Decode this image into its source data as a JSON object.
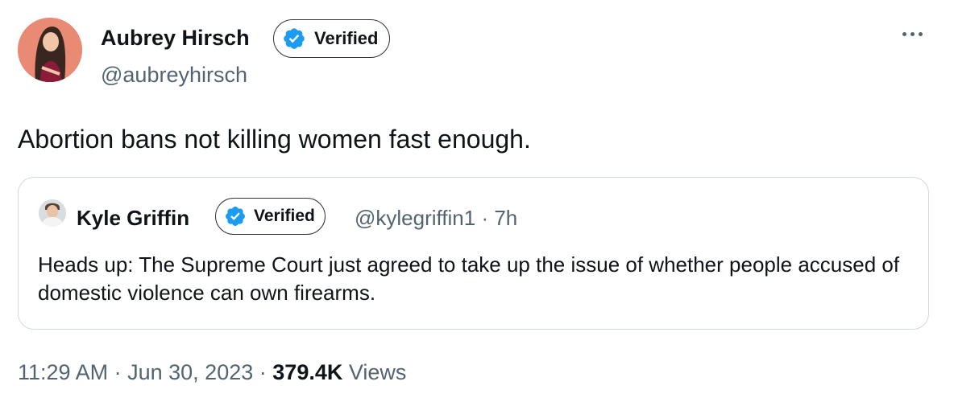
{
  "tweet": {
    "author": {
      "name": "Aubrey Hirsch",
      "handle": "@aubreyhirsch",
      "verified_label": "Verified"
    },
    "text": "Abortion bans not killing women fast enough.",
    "quoted": {
      "author_name": "Kyle Griffin",
      "verified_label": "Verified",
      "handle": "@kylegriffin1",
      "separator": "·",
      "age": "7h",
      "text": "Heads up: The Supreme Court just agreed to take up the issue of whether people accused of domestic violence can own firearms."
    },
    "footer": {
      "time": "11:29 AM",
      "separator": "·",
      "date": "Jun 30, 2023",
      "views_count": "379.4K",
      "views_label": "Views"
    }
  },
  "colors": {
    "verified_blue": "#1d9bf0",
    "secondary_text": "#536471",
    "primary_text": "#0f1419",
    "card_border": "#cfd9de"
  },
  "icons": {
    "more": "more-horizontal-icon",
    "verified": "verified-badge-icon"
  }
}
